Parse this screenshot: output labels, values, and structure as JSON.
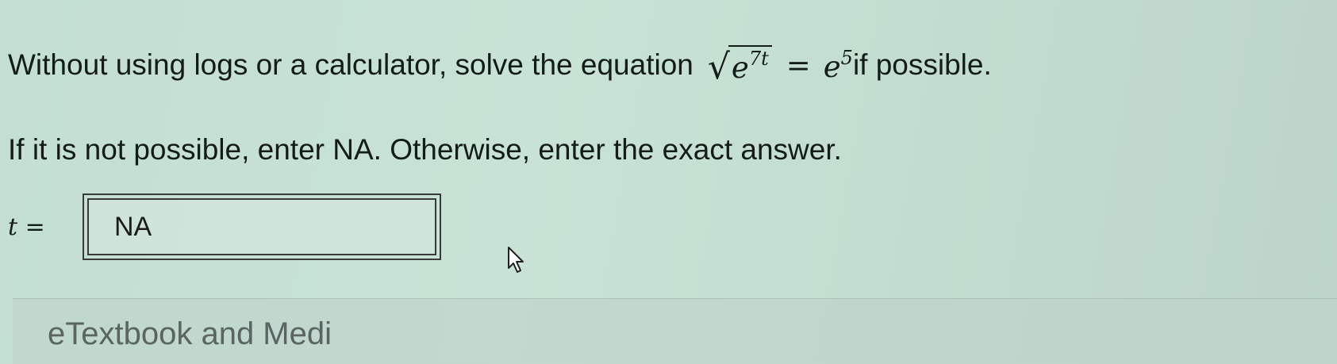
{
  "question": {
    "lead_text": "Without using logs or a calculator, solve the equation",
    "equation": {
      "radicand_base": "e",
      "radicand_exponent": "7t",
      "equals": "=",
      "rhs_base": "e",
      "rhs_exponent": "5"
    },
    "trailing_text": "if possible."
  },
  "instruction": "If it is not possible, enter NA. Otherwise, enter the exact answer.",
  "answer": {
    "variable_label": "t =",
    "value": "NA"
  },
  "footer": {
    "partial_link_text": "eTextbook and Medi"
  }
}
